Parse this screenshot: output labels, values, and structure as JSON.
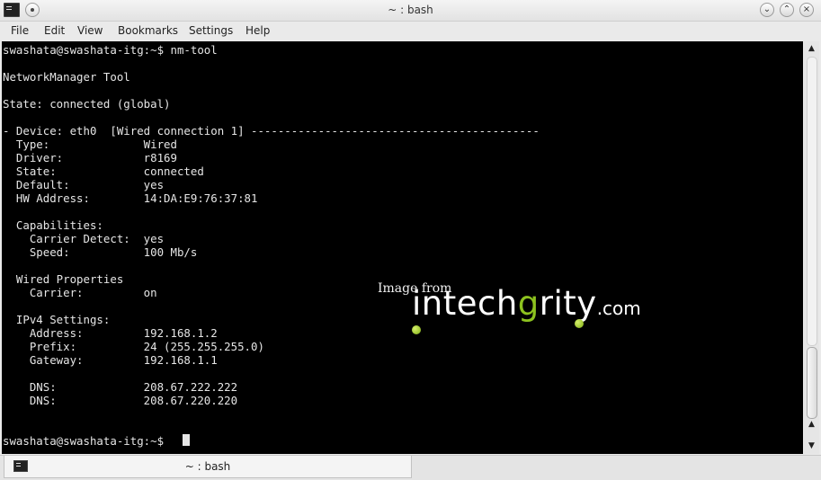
{
  "window": {
    "title": "~ : bash"
  },
  "menu": [
    "File",
    "Edit",
    "View",
    "Bookmarks",
    "Settings",
    "Help"
  ],
  "terminal": {
    "lines": [
      "swashata@swashata-itg:~$ nm-tool",
      "",
      "NetworkManager Tool",
      "",
      "State: connected (global)",
      "",
      "- Device: eth0  [Wired connection 1] -------------------------------------------",
      "  Type:              Wired",
      "  Driver:            r8169",
      "  State:             connected",
      "  Default:           yes",
      "  HW Address:        14:DA:E9:76:37:81",
      "",
      "  Capabilities:",
      "    Carrier Detect:  yes",
      "    Speed:           100 Mb/s",
      "",
      "  Wired Properties",
      "    Carrier:         on",
      "",
      "  IPv4 Settings:",
      "    Address:         192.168.1.2",
      "    Prefix:          24 (255.255.255.0)",
      "    Gateway:         192.168.1.1",
      "",
      "    DNS:             208.67.222.222",
      "    DNS:             208.67.220.220",
      "",
      "",
      "swashata@swashata-itg:~$ "
    ]
  },
  "watermark": {
    "prefix": "Image from",
    "brand_a": "intech",
    "brand_g": "g",
    "brand_b": "rity",
    "tld": ".com",
    "accent_color": "#8dc21f"
  },
  "tab": {
    "label": "~ : bash"
  }
}
